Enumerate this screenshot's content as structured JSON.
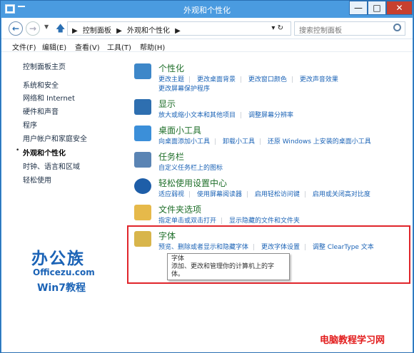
{
  "window": {
    "title": "外观和个性化",
    "min_glyph": "—",
    "max_glyph": "□",
    "close_glyph": "✕"
  },
  "address": {
    "back_glyph": "←",
    "fwd_glyph": "→",
    "dropdown_glyph": "▼",
    "up_glyph": "🡅",
    "crumbs": [
      "▶",
      "控制面板",
      "▶",
      "外观和个性化",
      "▶"
    ],
    "refresh_glyph": "▾ ↻",
    "search_placeholder": "搜索控制面板"
  },
  "menu": [
    "文件(F)",
    "编辑(E)",
    "查看(V)",
    "工具(T)",
    "帮助(H)"
  ],
  "sidebar": {
    "items": [
      "控制面板主页",
      "系统和安全",
      "网络和 Internet",
      "硬件和声音",
      "程序",
      "用户帐户和家庭安全",
      "外观和个性化",
      "时钟、语言和区域",
      "轻松使用"
    ],
    "current_marker": "•"
  },
  "categories": [
    {
      "title": "个性化",
      "links": [
        "更改主题",
        "更改桌面背景",
        "更改窗口颜色",
        "更改声音效果"
      ],
      "links2": [
        "更改屏幕保护程序"
      ],
      "color": "#3d87c9"
    },
    {
      "title": "显示",
      "links": [
        "放大或缩小文本和其他项目",
        "调整屏幕分辨率"
      ],
      "links2": [],
      "color": "#2e6fb0"
    },
    {
      "title": "桌面小工具",
      "links": [
        "向桌面添加小工具",
        "卸载小工具",
        "还原 Windows 上安装的桌面小工具"
      ],
      "links2": [],
      "color": "#3b8fd9"
    },
    {
      "title": "任务栏",
      "links": [
        "自定义任务栏上的图标"
      ],
      "links2": [],
      "color": "#5a84b4"
    },
    {
      "title": "轻松使用设置中心",
      "links": [
        "适应弱视",
        "使用屏幕阅读器",
        "启用轻松访问键",
        "启用或关闭高对比度"
      ],
      "links2": [],
      "color": "#1e5ea8"
    },
    {
      "title": "文件夹选项",
      "links": [
        "指定单击或双击打开",
        "显示隐藏的文件和文件夹"
      ],
      "links2": [],
      "color": "#e6b94a"
    },
    {
      "title": "字体",
      "links": [
        "预览、删除或者显示和隐藏字体",
        "更改字体设置",
        "调整 ClearType 文本"
      ],
      "links2": [],
      "color": "#d8b54b"
    }
  ],
  "tooltip": {
    "title": "字体",
    "body": "添加、更改和管理你的计算机上的字体。"
  },
  "logo": {
    "line1": "办公族",
    "line2": "Officezu.com",
    "line3": "Win7教程"
  },
  "watermark": "电脑教程学习网"
}
